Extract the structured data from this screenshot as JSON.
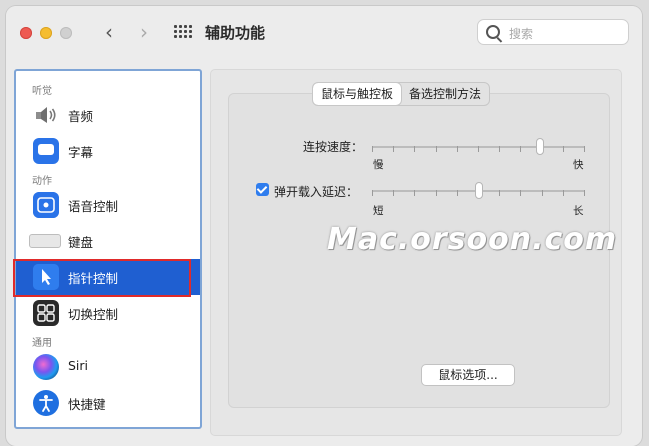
{
  "window": {
    "title": "辅助功能"
  },
  "search": {
    "placeholder": "搜索"
  },
  "sidebar": {
    "sections": {
      "hearing": "听觉",
      "motor": "动作",
      "general": "通用"
    },
    "items": [
      {
        "label": "音频",
        "icon": "speaker-icon"
      },
      {
        "label": "字幕",
        "icon": "captions-icon"
      },
      {
        "label": "语音控制",
        "icon": "voice-control-icon"
      },
      {
        "label": "键盘",
        "icon": "keyboard-icon"
      },
      {
        "label": "指针控制",
        "icon": "pointer-icon",
        "selected": true
      },
      {
        "label": "切换控制",
        "icon": "switch-control-icon"
      },
      {
        "label": "Siri",
        "icon": "siri-icon"
      },
      {
        "label": "快捷键",
        "icon": "accessibility-shortcut-icon"
      }
    ]
  },
  "tabs": [
    {
      "label": "鼠标与触控板",
      "active": true
    },
    {
      "label": "备选控制方法",
      "active": false
    }
  ],
  "settings": {
    "double_click": {
      "label": "连按速度：",
      "min_label": "慢",
      "max_label": "快",
      "value": 0.79
    },
    "spring_loading": {
      "label": "弹开载入延迟：",
      "checked": true,
      "min_label": "短",
      "max_label": "长",
      "value": 0.5
    }
  },
  "buttons": {
    "mouse_options": "鼠标选项..."
  },
  "watermark": "Mac.orsoon.com",
  "colors": {
    "selection": "#1f5fd1",
    "accent": "#2f7dee",
    "highlight": "#e02a2a"
  }
}
